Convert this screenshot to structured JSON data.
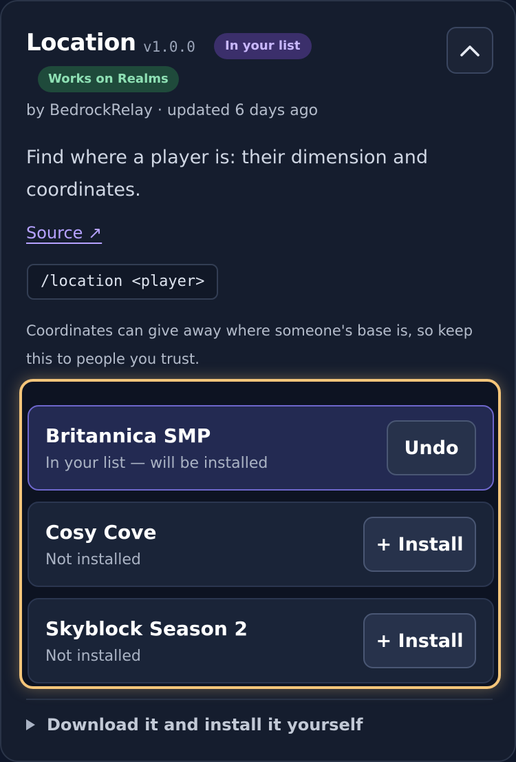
{
  "plugin": {
    "title": "Location",
    "version": "v1.0.0",
    "badges": {
      "in_list": "In your list",
      "realms": "Works on Realms"
    },
    "byline": "by BedrockRelay · updated 6 days ago",
    "description": "Find where a player is: their dimension and coordinates.",
    "source_label": "Source ↗",
    "command": "/location <player>",
    "warning": "Coordinates can give away where someone's base is, so keep this to people you trust."
  },
  "icons": {
    "collapse": "chevron-up-icon",
    "expander": "triangle-right-icon"
  },
  "realms": [
    {
      "name": "Britannica SMP",
      "status": "In your list — will be installed",
      "action": "Undo",
      "selected": true
    },
    {
      "name": "Cosy Cove",
      "status": "Not installed",
      "action": "+ Install",
      "selected": false
    },
    {
      "name": "Skyblock Season 2",
      "status": "Not installed",
      "action": "+ Install",
      "selected": false
    }
  ],
  "download": {
    "label": "Download it and install it yourself"
  },
  "colors": {
    "highlight": "#f5c57a",
    "selected_border": "#6e67cc",
    "link": "#b6a2ff"
  }
}
